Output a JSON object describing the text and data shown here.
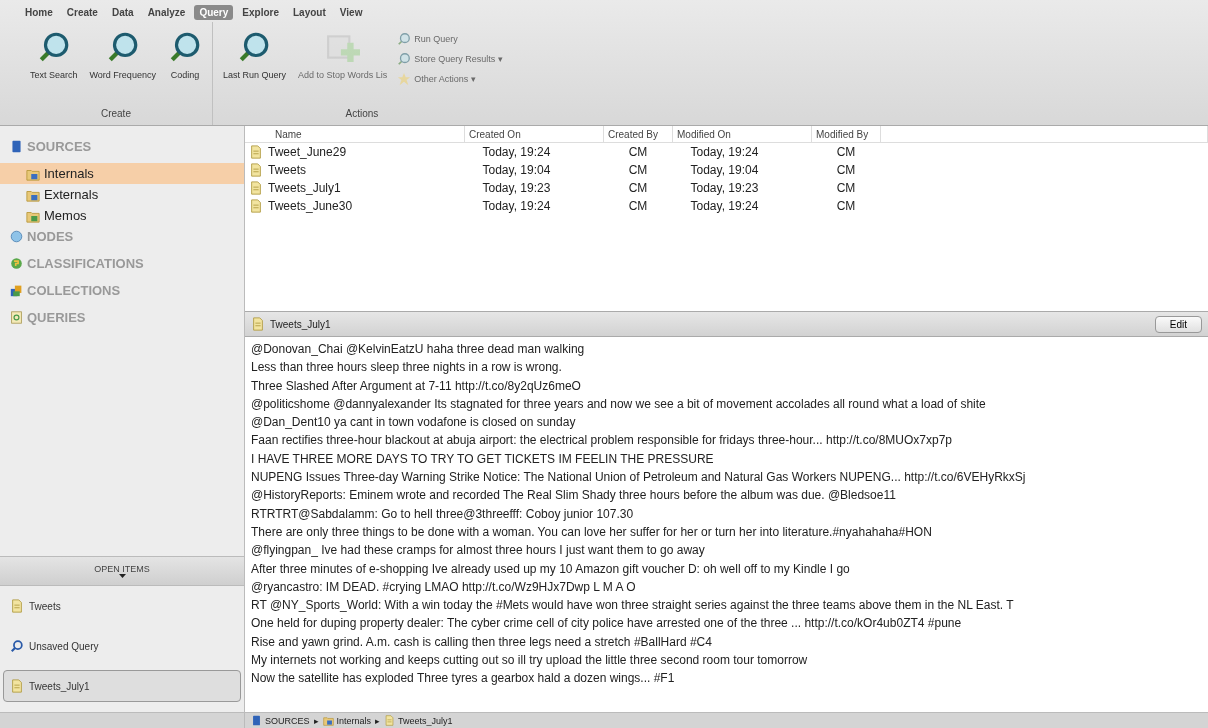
{
  "menu_tabs": [
    {
      "label": "Home",
      "selected": false
    },
    {
      "label": "Create",
      "selected": false
    },
    {
      "label": "Data",
      "selected": false
    },
    {
      "label": "Analyze",
      "selected": false
    },
    {
      "label": "Query",
      "selected": true
    },
    {
      "label": "Explore",
      "selected": false
    },
    {
      "label": "Layout",
      "selected": false
    },
    {
      "label": "View",
      "selected": false
    }
  ],
  "ribbon": {
    "groups": [
      {
        "label": "Create",
        "buttons": [
          {
            "label": "Text Search",
            "kind": "large",
            "disabled": false
          },
          {
            "label": "Word Frequency",
            "kind": "large",
            "disabled": false
          },
          {
            "label": "Coding",
            "kind": "large",
            "disabled": false
          }
        ]
      },
      {
        "label": "Actions",
        "buttons": [
          {
            "label": "Last Run Query",
            "kind": "large",
            "disabled": false
          },
          {
            "label": "Add to Stop Words Lis",
            "kind": "large",
            "disabled": true
          },
          {
            "label": "Run Query",
            "kind": "small",
            "disabled": true
          },
          {
            "label": "Store Query Results ▾",
            "kind": "small",
            "disabled": true
          },
          {
            "label": "Other Actions ▾",
            "kind": "small",
            "disabled": true
          }
        ]
      }
    ]
  },
  "sidebar": {
    "sections": [
      {
        "label": "SOURCES",
        "kind": "sources",
        "children": [
          {
            "label": "Internals",
            "selected": true
          },
          {
            "label": "Externals",
            "selected": false
          },
          {
            "label": "Memos",
            "selected": false
          }
        ]
      },
      {
        "label": "NODES",
        "kind": "nodes"
      },
      {
        "label": "CLASSIFICATIONS",
        "kind": "classifications"
      },
      {
        "label": "COLLECTIONS",
        "kind": "collections"
      },
      {
        "label": "QUERIES",
        "kind": "queries"
      }
    ],
    "open_items_header": "OPEN ITEMS",
    "open_items": [
      {
        "label": "Tweets",
        "kind": "document",
        "selected": false
      },
      {
        "label": "Unsaved Query",
        "kind": "query",
        "selected": false
      },
      {
        "label": "Tweets_July1",
        "kind": "document",
        "selected": true
      }
    ]
  },
  "table": {
    "columns": [
      "Name",
      "Created On",
      "Created By",
      "Modified On",
      "Modified By"
    ],
    "rows": [
      [
        "Tweet_June29",
        "Today, 19:24",
        "CM",
        "Today, 19:24",
        "CM"
      ],
      [
        "Tweets",
        "Today, 19:04",
        "CM",
        "Today, 19:04",
        "CM"
      ],
      [
        "Tweets_July1",
        "Today, 19:23",
        "CM",
        "Today, 19:23",
        "CM"
      ],
      [
        "Tweets_June30",
        "Today, 19:24",
        "CM",
        "Today, 19:24",
        "CM"
      ]
    ]
  },
  "preview": {
    "title": "Tweets_July1",
    "edit_button": "Edit",
    "lines": [
      "@Donovan_Chai @KelvinEatzU haha three dead man walking",
      "Less than three hours sleep three nights in a row is  wrong.",
      "Three Slashed After Argument at 7-11 http://t.co/8y2qUz6meO",
      "@politicshome @dannyalexander Its stagnated for three years and now we see a bit of movement accolades all round what a load of shite",
      "@Dan_Dent10 ya cant in town vodafone is closed on sunday",
      "Faan rectifies three-hour blackout at abuja airport: the electrical problem responsible for fridays three-hour... http://t.co/8MUOx7xp7p",
      "I HAVE THREE MORE DAYS TO TRY TO GET TICKETS IM FEELIN THE PRESSURE",
      "NUPENG Issues Three-day Warning Strike Notice: The National Union of Petroleum and Natural Gas Workers NUPENG... http://t.co/6VEHyRkxSj",
      "@HistoryReports: Eminem wrote and recorded The Real Slim Shady three hours before the album was due. @Bledsoe11",
      "RTRTRT@Sabdalamm: Go to hell three@3threefff: Coboy junior  107.30",
      "There are only three things to be done with a woman. You can love her suffer for her or turn her into literature.#nyahahaha#HON",
      "@flyingpan_ Ive had these cramps for almost three hours I just want them to go away",
      "After three minutes of e-shopping Ive already used up my 10 Amazon gift voucher D: oh well off to my Kindle I go",
      "@ryancastro: IM DEAD. #crying LMAO http://t.co/Wz9HJx7Dwp L M A O",
      "RT @NY_Sports_World: With a win today the #Mets would have won three straight series against the three teams above them in the NL East. T",
      "One held for duping property dealer: The cyber crime cell of city police have arrested one of the three ... http://t.co/kOr4ub0ZT4 #pune",
      "Rise and yawn grind. A.m. cash is calling then three legs need a stretch #BallHard #C4",
      "My internets not working and keeps cutting out so ill try upload the little three second room tour tomorrow",
      "Now the satellite has exploded Three tyres a gearbox hald a dozen wings... #F1"
    ]
  },
  "breadcrumb": {
    "separator": "▸",
    "items": [
      "SOURCES",
      "Internals",
      "Tweets_July1"
    ]
  }
}
